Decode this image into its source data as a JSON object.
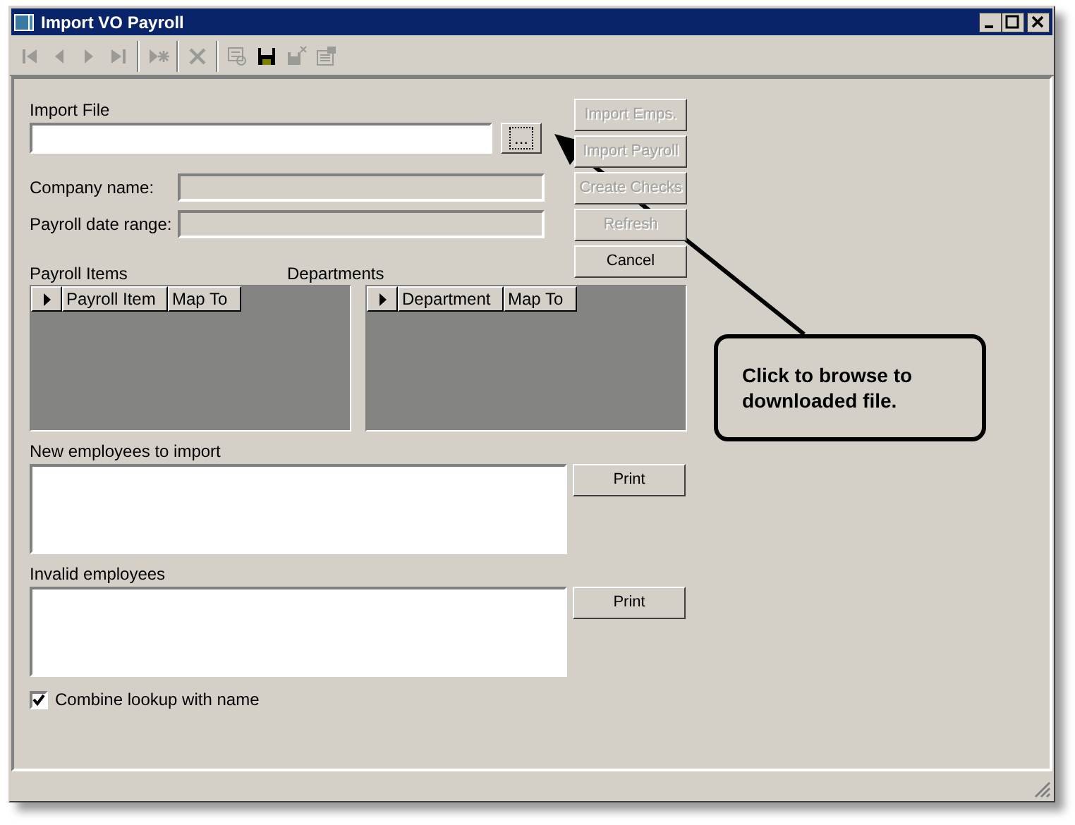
{
  "window": {
    "title": "Import VO Payroll"
  },
  "toolbar": [
    {
      "kind": "first",
      "disabled": true
    },
    {
      "kind": "prev",
      "disabled": true
    },
    {
      "kind": "next",
      "disabled": true
    },
    {
      "kind": "last",
      "disabled": true
    },
    {
      "kind": "new",
      "disabled": true
    },
    {
      "kind": "delete",
      "disabled": true
    },
    {
      "kind": "find",
      "disabled": true
    },
    {
      "kind": "save",
      "disabled": false
    },
    {
      "kind": "discard",
      "disabled": true
    },
    {
      "kind": "properties",
      "disabled": true
    }
  ],
  "import_file": {
    "label": "Import File",
    "browse_label": "..."
  },
  "fields": [
    {
      "label": "Company name:"
    },
    {
      "label": "Payroll date range:"
    }
  ],
  "action_buttons": [
    {
      "label": "Import Emps.",
      "disabled": true
    },
    {
      "label": "Import Payroll",
      "disabled": true
    },
    {
      "label": "Create Checks",
      "disabled": true
    },
    {
      "label": "Refresh",
      "disabled": true
    },
    {
      "label": "Cancel",
      "disabled": false
    }
  ],
  "grids": [
    {
      "title": "Payroll Items",
      "columns": [
        "Payroll Item",
        "Map To"
      ]
    },
    {
      "title": "Departments",
      "columns": [
        "Department",
        "Map To"
      ]
    }
  ],
  "lists": [
    {
      "label": "New employees to import",
      "button": "Print"
    },
    {
      "label": "Invalid employees",
      "button": "Print"
    }
  ],
  "checkbox": {
    "label": "Combine lookup with name",
    "checked": true
  },
  "callout": {
    "text": "Click to browse to downloaded file."
  }
}
